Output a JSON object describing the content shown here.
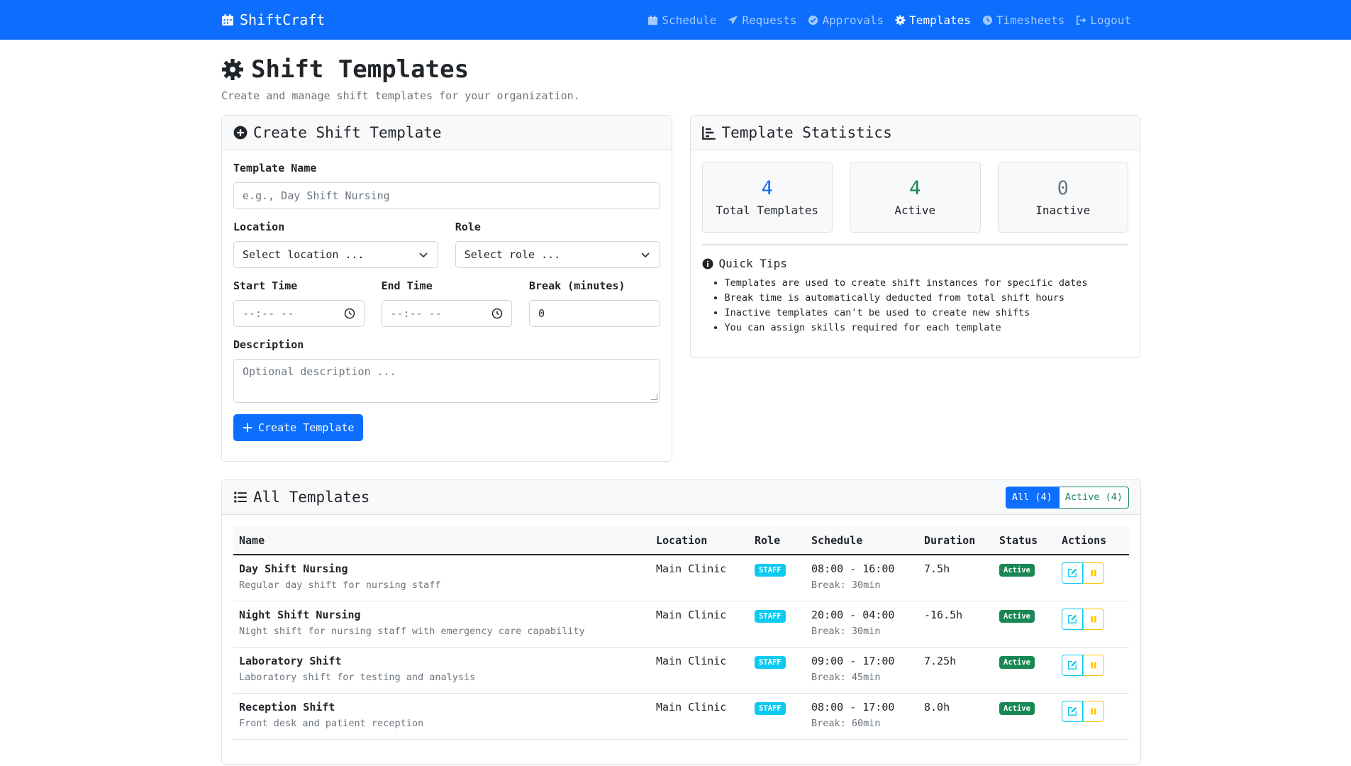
{
  "nav": {
    "brand": "ShiftCraft",
    "links": [
      {
        "label": "Schedule",
        "icon": "calendar-icon"
      },
      {
        "label": "Requests",
        "icon": "paper-plane-icon"
      },
      {
        "label": "Approvals",
        "icon": "check-circle-icon"
      },
      {
        "label": "Templates",
        "icon": "gear-icon",
        "active": true
      },
      {
        "label": "Timesheets",
        "icon": "clock-icon"
      },
      {
        "label": "Logout",
        "icon": "logout-icon"
      }
    ]
  },
  "page": {
    "title": "Shift Templates",
    "subtitle": "Create and manage shift templates for your organization."
  },
  "form": {
    "header": "Create Shift Template",
    "name_label": "Template Name",
    "name_placeholder": "e.g., Day Shift Nursing",
    "location_label": "Location",
    "location_value": "Select location ...",
    "role_label": "Role",
    "role_value": "Select role ...",
    "start_label": "Start Time",
    "start_value": "--:-- --",
    "end_label": "End Time",
    "end_value": "--:-- --",
    "break_label": "Break (minutes)",
    "break_value": "0",
    "description_label": "Description",
    "description_placeholder": "Optional description ...",
    "submit_label": "Create Template"
  },
  "stats": {
    "header": "Template Statistics",
    "total": {
      "value": "4",
      "label": "Total Templates",
      "color": "#0d6efd"
    },
    "active": {
      "value": "4",
      "label": "Active",
      "color": "#198754"
    },
    "inactive": {
      "value": "0",
      "label": "Inactive",
      "color": "#6c757d"
    },
    "tips_title": "Quick Tips",
    "tips": [
      "Templates are used to create shift instances for specific dates",
      "Break time is automatically deducted from total shift hours",
      "Inactive templates can't be used to create new shifts",
      "You can assign skills required for each template"
    ]
  },
  "templates": {
    "header": "All Templates",
    "filter_all": "All (4)",
    "filter_active": "Active (4)",
    "columns": [
      "Name",
      "Location",
      "Role",
      "Schedule",
      "Duration",
      "Status",
      "Actions"
    ],
    "rows": [
      {
        "name": "Day Shift Nursing",
        "description": "Regular day shift for nursing staff",
        "location": "Main Clinic",
        "role": "STAFF",
        "schedule": "08:00 - 16:00",
        "break": "Break: 30min",
        "duration": "7.5h",
        "status": "Active"
      },
      {
        "name": "Night Shift Nursing",
        "description": "Night shift for nursing staff with emergency care capability",
        "location": "Main Clinic",
        "role": "STAFF",
        "schedule": "20:00 - 04:00",
        "break": "Break: 30min",
        "duration": "-16.5h",
        "status": "Active"
      },
      {
        "name": "Laboratory Shift",
        "description": "Laboratory shift for testing and analysis",
        "location": "Main Clinic",
        "role": "STAFF",
        "schedule": "09:00 - 17:00",
        "break": "Break: 45min",
        "duration": "7.25h",
        "status": "Active"
      },
      {
        "name": "Reception Shift",
        "description": "Front desk and patient reception",
        "location": "Main Clinic",
        "role": "STAFF",
        "schedule": "08:00 - 17:00",
        "break": "Break: 60min",
        "duration": "8.0h",
        "status": "Active"
      }
    ]
  }
}
